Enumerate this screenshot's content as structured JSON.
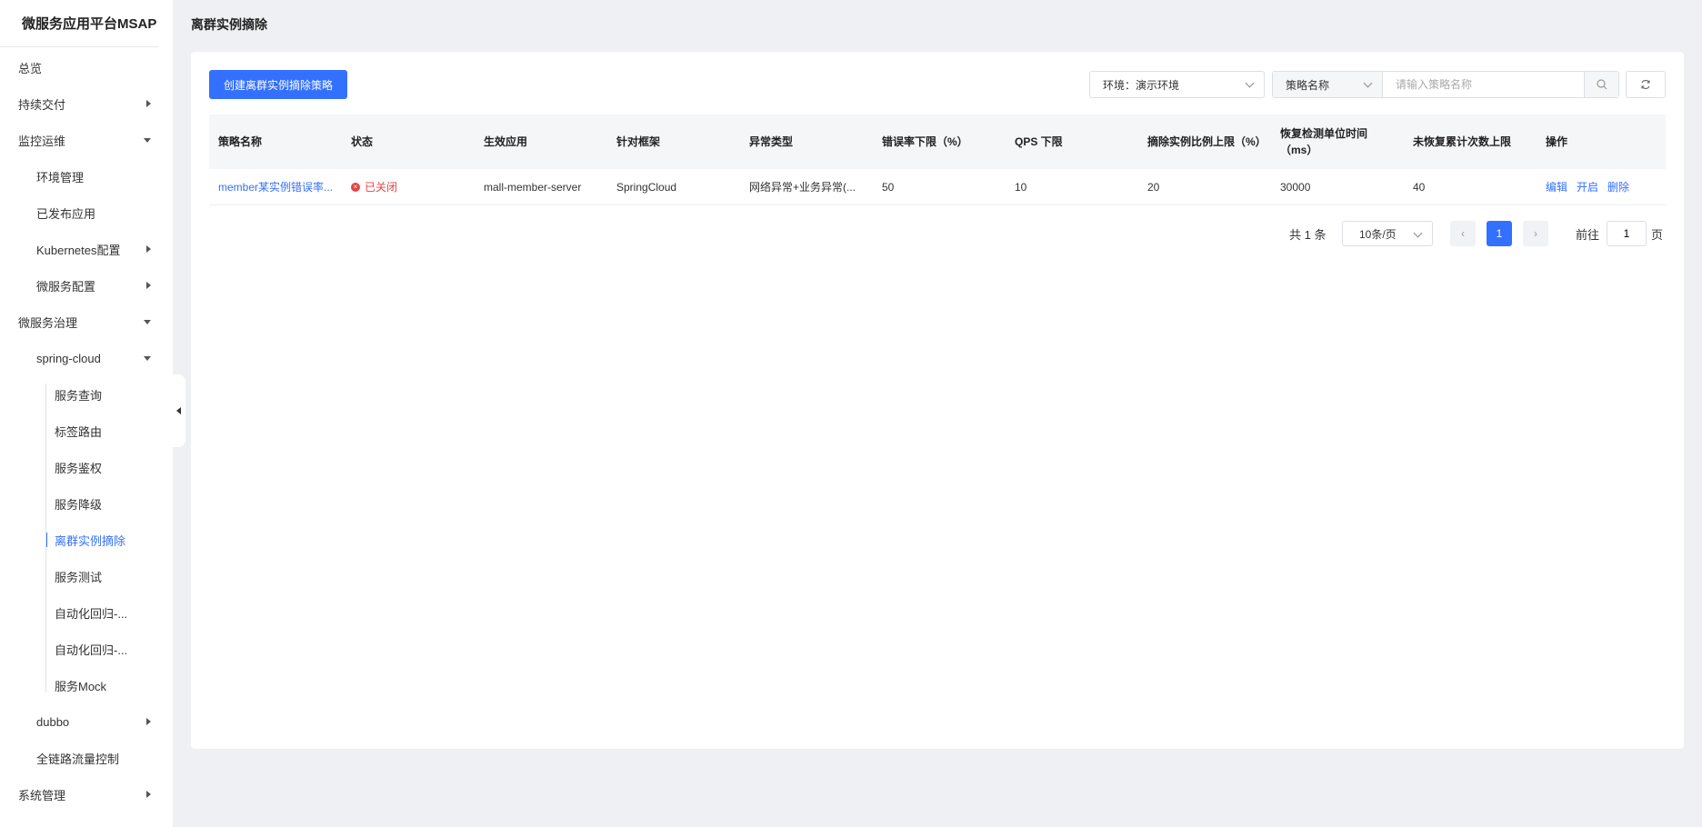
{
  "app": {
    "title": "微服务应用平台MSAP"
  },
  "sidebar": {
    "items": [
      {
        "label": "总览"
      },
      {
        "label": "持续交付"
      },
      {
        "label": "监控运维"
      },
      {
        "label": "环境管理"
      },
      {
        "label": "已发布应用"
      },
      {
        "label": "Kubernetes配置"
      },
      {
        "label": "微服务配置"
      },
      {
        "label": "微服务治理"
      },
      {
        "label": "spring-cloud"
      },
      {
        "label": "服务查询"
      },
      {
        "label": "标签路由"
      },
      {
        "label": "服务鉴权"
      },
      {
        "label": "服务降级"
      },
      {
        "label": "离群实例摘除"
      },
      {
        "label": "服务测试"
      },
      {
        "label": "自动化回归-..."
      },
      {
        "label": "自动化回归-..."
      },
      {
        "label": "服务Mock"
      },
      {
        "label": "dubbo"
      },
      {
        "label": "全链路流量控制"
      },
      {
        "label": "系统管理"
      }
    ]
  },
  "page": {
    "title": "离群实例摘除"
  },
  "toolbar": {
    "create_label": "创建离群实例摘除策略",
    "env_label": "环境：演示环境",
    "search_type": "策略名称",
    "search_placeholder": "请输入策略名称"
  },
  "table": {
    "headers": [
      "策略名称",
      "状态",
      "生效应用",
      "针对框架",
      "异常类型",
      "错误率下限（%）",
      "QPS 下限",
      "摘除实例比例上限（%）",
      "恢复检测单位时间（ms）",
      "未恢复累计次数上限",
      "操作"
    ],
    "rows": [
      {
        "name": "member某实例错误率...",
        "status": "已关闭",
        "app": "mall-member-server",
        "framework": "SpringCloud",
        "exception": "网络异常+业务异常(...",
        "error_rate": "50",
        "qps": "10",
        "ratio": "20",
        "interval": "30000",
        "count": "40",
        "actions": {
          "edit": "编辑",
          "enable": "开启",
          "delete": "删除"
        }
      }
    ]
  },
  "pagination": {
    "total": "共 1 条",
    "page_size": "10条/页",
    "current": "1",
    "goto_prefix": "前往",
    "goto_value": "1",
    "goto_suffix": "页"
  },
  "colors": {
    "primary": "#3370ff",
    "danger": "#e54545"
  }
}
